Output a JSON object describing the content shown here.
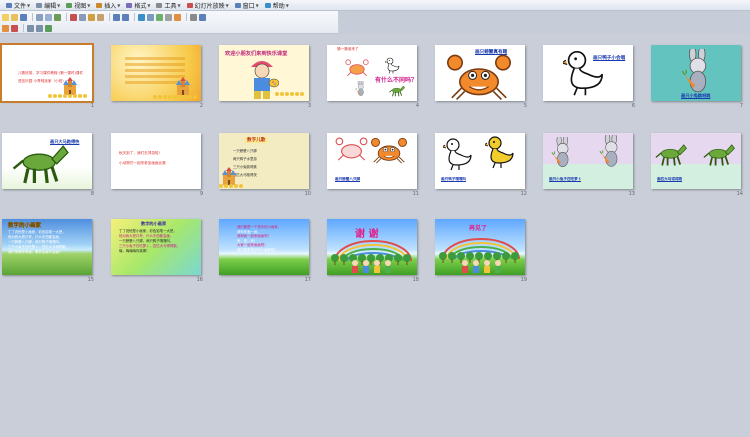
{
  "menu": {
    "items": [
      {
        "label": "文件",
        "icon_color": "#5b7fb8"
      },
      {
        "label": "编辑",
        "icon_color": "#7b8fa8"
      },
      {
        "label": "视图",
        "icon_color": "#5b9c5b"
      },
      {
        "label": "插入",
        "icon_color": "#c88a2c"
      },
      {
        "label": "格式",
        "icon_color": "#7b6bb8"
      },
      {
        "label": "工具",
        "icon_color": "#8a8a8a"
      },
      {
        "label": "幻灯片放映",
        "icon_color": "#c85050"
      },
      {
        "label": "窗口",
        "icon_color": "#5b7fb8"
      },
      {
        "label": "帮助",
        "icon_color": "#3b8fc8"
      }
    ]
  },
  "slides": [
    {
      "num": "1",
      "lines": [
        "儿歌欣赏、学习课件教程·(第一课时)课件",
        "语言乐园  小青蛙找家（小班）"
      ]
    },
    {
      "num": "2",
      "lines": [
        "",
        "",
        "",
        "",
        ""
      ]
    },
    {
      "num": "3",
      "title": "欢迎小朋友们来到快乐课堂"
    },
    {
      "num": "4",
      "caption": "猜一猜谁来了",
      "big": "有什么不同吗？"
    },
    {
      "num": "5",
      "title": "画只螃蟹真有趣"
    },
    {
      "num": "6",
      "title": "画只鸭子小会唱"
    },
    {
      "num": "7",
      "title": "画只小兔跳呀跳"
    },
    {
      "num": "8",
      "title": "画只大马跑得快"
    },
    {
      "num": "9",
      "lines": [
        "秋天到了，我们去郊游啦！",
        "小动物们一起来参加画画比赛"
      ]
    },
    {
      "num": "10",
      "title": "数字儿歌",
      "rows": [
        "一只螃蟹八只脚",
        "两只鸭子水里游",
        "三只小兔跳呀跳",
        "四匹大马跑得快"
      ]
    },
    {
      "num": "11",
      "caption": "画只螃蟹八只脚"
    },
    {
      "num": "12",
      "caption": "画只鸭子嘎嘎叫"
    },
    {
      "num": "13",
      "caption": "画只小兔子在吃萝卜"
    },
    {
      "num": "14",
      "caption": "画匹大马得得跑"
    },
    {
      "num": "15",
      "title": "数字的小画家",
      "lines": [
        "丁丁说他是小画家，彩色铅笔一大把，",
        "他对我大把口夸，什么东西都会画，",
        "一只螃蟹八只脚，两只鸭子嘎嘎叫，",
        "三只小兔子在吃萝卜，四匹大马得得跑，",
        "我们来教你来画，看你会画不会画？"
      ]
    },
    {
      "num": "16",
      "title": "数字的小画家",
      "lines": [
        "丁丁说他是小画家，彩色铅笔一大把，",
        "他对我大把口夸，什么东西都会画，",
        "一只螃蟹八只脚，两只鸭子嘎嘎叫，",
        "三只小兔子在吃萝卜，四匹大马得得跑，",
        "嗨，嗨嗨嗨你真棒！"
      ]
    },
    {
      "num": "17",
      "lines": [
        "我们都是一个快乐的小画家，",
        "请你来画一画，",
        "请和我一起来画画吧！",
        "来，来，来！",
        "大家一起来画画吧！",
        "我们都是快乐的小画家啦！"
      ]
    },
    {
      "num": "18",
      "big": "谢 谢"
    },
    {
      "num": "19",
      "big": "再见了"
    }
  ]
}
